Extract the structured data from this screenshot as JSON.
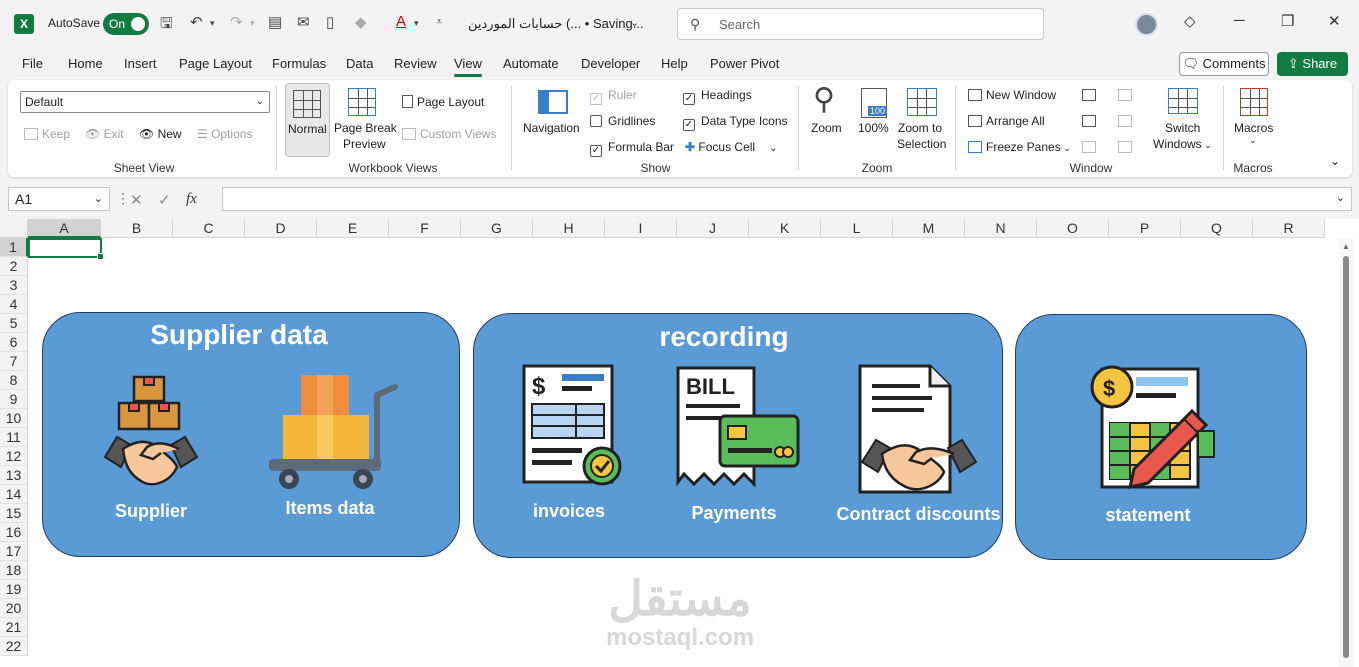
{
  "titlebar": {
    "app_icon": "X",
    "autosave_label": "AutoSave",
    "autosave_state": "On",
    "document_title": "حسابات الموردين (... • Saving...",
    "search_placeholder": "Search",
    "icons": [
      "save-icon",
      "undo-icon",
      "redo-icon",
      "diamond-icon",
      "minimize-icon",
      "restore-icon",
      "close-icon"
    ]
  },
  "menu": {
    "tabs": [
      "File",
      "Home",
      "Insert",
      "Page Layout",
      "Formulas",
      "Data",
      "Review",
      "View",
      "Automate",
      "Developer",
      "Help",
      "Power Pivot"
    ],
    "active_tab": "View",
    "comments_label": "Comments",
    "share_label": "Share"
  },
  "ribbon": {
    "sheet_view": {
      "select_value": "Default",
      "keep": "Keep",
      "exit": "Exit",
      "new": "New",
      "options": "Options",
      "label": "Sheet View"
    },
    "workbook_views": {
      "normal": "Normal",
      "page_break_1": "Page Break",
      "page_break_2": "Preview",
      "page_layout": "Page Layout",
      "custom_views": "Custom Views",
      "label": "Workbook Views"
    },
    "show": {
      "navigation": "Navigation",
      "ruler": "Ruler",
      "gridlines": "Gridlines",
      "formula_bar": "Formula Bar",
      "headings": "Headings",
      "data_type_icons": "Data Type Icons",
      "focus_cell": "Focus Cell",
      "label": "Show"
    },
    "zoom": {
      "zoom": "Zoom",
      "hundred": "100%",
      "zoom_to_1": "Zoom to",
      "zoom_to_2": "Selection",
      "icon_value": "100",
      "label": "Zoom"
    },
    "window": {
      "new_window": "New Window",
      "arrange_all": "Arrange All",
      "freeze_panes": "Freeze Panes",
      "switch_1": "Switch",
      "switch_2": "Windows",
      "label": "Window"
    },
    "macros": {
      "macros": "Macros",
      "label": "Macros"
    }
  },
  "formula_bar": {
    "name_box": "A1",
    "fx": "fx",
    "value": ""
  },
  "sheet": {
    "columns": [
      "A",
      "B",
      "C",
      "D",
      "E",
      "F",
      "G",
      "H",
      "I",
      "J",
      "K",
      "L",
      "M",
      "N",
      "O",
      "P",
      "Q",
      "R"
    ],
    "rows": [
      "1",
      "2",
      "3",
      "4",
      "5",
      "6",
      "7",
      "8",
      "9",
      "10",
      "11",
      "12",
      "13",
      "14",
      "15",
      "16",
      "17",
      "18",
      "19",
      "20",
      "21",
      "22"
    ],
    "selected_cell": "A1"
  },
  "cards": {
    "supplier_data": {
      "title": "Supplier data",
      "supplier": "Supplier",
      "items": "Items data"
    },
    "recording": {
      "title": "recording",
      "invoices": "invoices",
      "payments": "Payments",
      "contract_discounts": "Contract discounts",
      "bill_text": "BILL",
      "dollar": "$"
    },
    "statement": {
      "label": "statement",
      "dollar": "$"
    }
  },
  "watermark": {
    "arabic": "مستقل",
    "latin": "mostaql.com"
  },
  "colors": {
    "excel_green": "#107c41",
    "card_blue": "#5b9bd5",
    "card_border": "#1f3e66"
  }
}
